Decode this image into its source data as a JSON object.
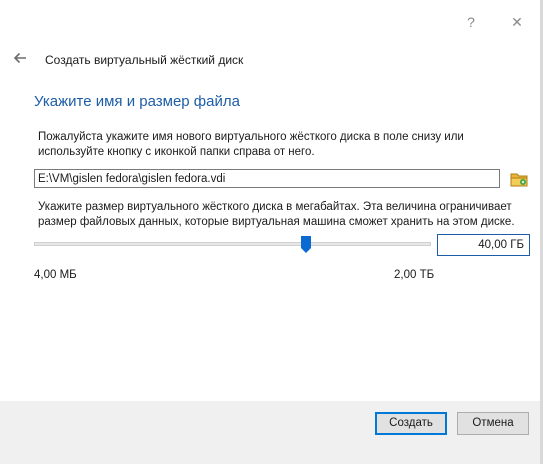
{
  "window": {
    "help_label": "?",
    "close_label": "✕"
  },
  "header": {
    "title": "Создать виртуальный жёсткий диск",
    "back_icon": "arrow-left-icon"
  },
  "page": {
    "title": "Укажите имя и размер файла",
    "name_description": "Пожалуйста укажите имя нового виртуального жёсткого диска в поле снизу или используйте кнопку с иконкой папки справа от него.",
    "file_path": "E:\\VM\\gislen fedora\\gislen fedora.vdi",
    "size_description": "Укажите размер виртуального жёсткого диска в мегабайтах. Эта величина ограничивает размер файловых данных, которые виртуальная машина сможет хранить на этом диске.",
    "size_value": "40,00 ГБ",
    "slider_min_label": "4,00 МБ",
    "slider_max_label": "2,00 ТБ",
    "slider_position": 0.69
  },
  "buttons": {
    "create": "Создать",
    "cancel": "Отмена"
  },
  "colors": {
    "accent": "#1d5da8",
    "thumb": "#0a6ad2",
    "default_button_border": "#0078d7"
  }
}
